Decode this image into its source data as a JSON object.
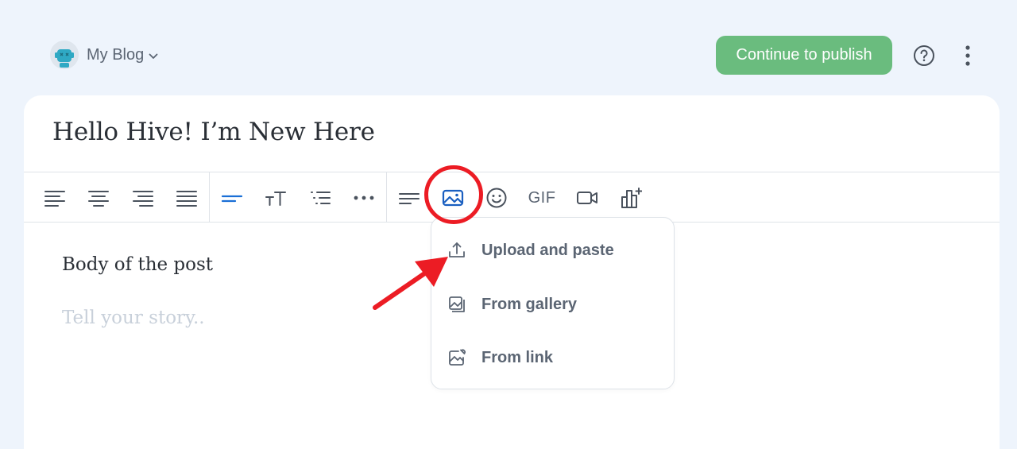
{
  "header": {
    "blog_name": "My Blog",
    "publish_label": "Continue to publish"
  },
  "editor": {
    "title": "Hello Hive! I’m New Here",
    "body_label": "Body of the post",
    "story_placeholder": "Tell your story.."
  },
  "toolbar": {
    "gif_label": "GIF",
    "buttons": [
      {
        "name": "align-left-icon"
      },
      {
        "name": "align-center-icon"
      },
      {
        "name": "align-right-icon"
      },
      {
        "name": "align-justify-icon"
      },
      {
        "name": "text-style-icon"
      },
      {
        "name": "text-size-icon"
      },
      {
        "name": "list-icon"
      },
      {
        "name": "more-dots-icon"
      },
      {
        "name": "paragraph-icon"
      },
      {
        "name": "image-icon"
      },
      {
        "name": "emoji-icon"
      },
      {
        "name": "gif-button"
      },
      {
        "name": "video-icon"
      },
      {
        "name": "chart-icon"
      }
    ]
  },
  "image_menu": {
    "items": [
      {
        "label": "Upload and paste",
        "icon": "upload-icon"
      },
      {
        "label": "From gallery",
        "icon": "gallery-icon"
      },
      {
        "label": "From link",
        "icon": "link-image-icon"
      }
    ]
  },
  "colors": {
    "background": "#eef4fc",
    "publish_green": "#6abc7e",
    "accent_blue": "#1a6fd6",
    "annotation_red": "#ec1c24",
    "text_gray": "#5b6573"
  }
}
